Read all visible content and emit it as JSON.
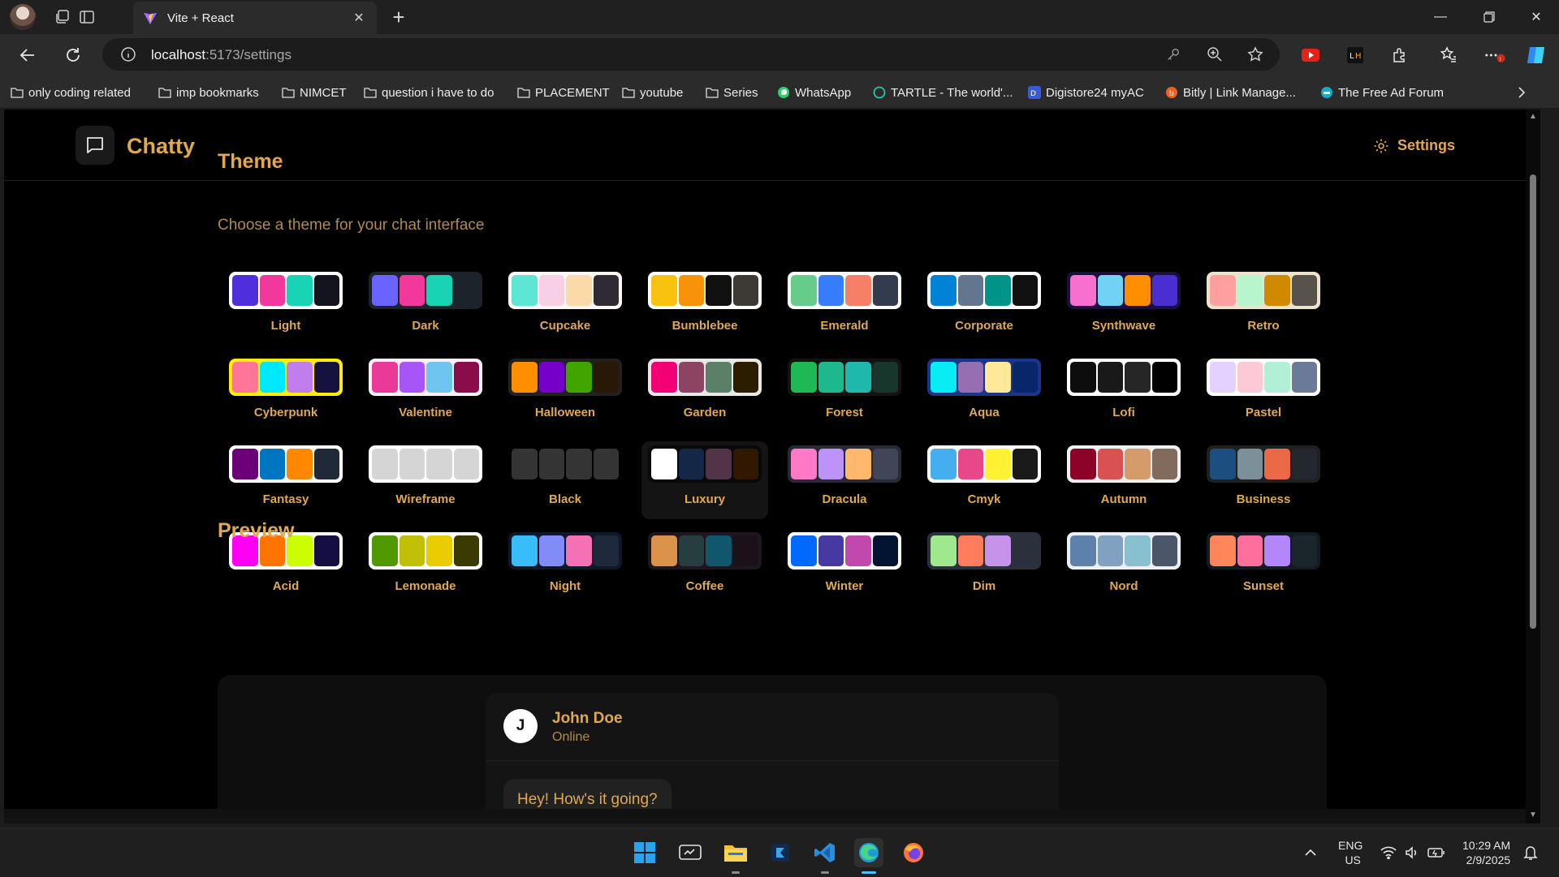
{
  "browser": {
    "tab_title": "Vite + React",
    "url_host": "localhost",
    "url_path": ":5173/settings",
    "bookmarks": [
      "only coding  related",
      "imp bookmarks",
      "NIMCET",
      "question i have to do",
      "PLACEMENT",
      "youtube",
      "Series",
      "WhatsApp",
      "TARTLE - The world'...",
      "Digistore24 myAC",
      "Bitly | Link Manage...",
      "The Free Ad Forum"
    ]
  },
  "app": {
    "name": "Chatty",
    "settings_label": "Settings",
    "theme_title": "Theme",
    "theme_subtitle": "Choose a theme for your chat interface",
    "preview_title": "Preview",
    "selected_theme": "Luxury",
    "themes": [
      {
        "name": "Light",
        "bg": "#ffffff",
        "colors": [
          "#4f2fdc",
          "#f2389c",
          "#19d3b5",
          "#14141f"
        ]
      },
      {
        "name": "Dark",
        "bg": "#1d232a",
        "colors": [
          "#6b63ff",
          "#f2389c",
          "#19d3b5",
          "#1d232a"
        ]
      },
      {
        "name": "Cupcake",
        "bg": "#faf7f5",
        "colors": [
          "#5ce6d3",
          "#f7d0e6",
          "#fcd9a8",
          "#2f2a33"
        ]
      },
      {
        "name": "Bumblebee",
        "bg": "#ffffff",
        "colors": [
          "#f9c20f",
          "#f79209",
          "#111111",
          "#3d3935"
        ]
      },
      {
        "name": "Emerald",
        "bg": "#ffffff",
        "colors": [
          "#66cc8a",
          "#377cfb",
          "#f68067",
          "#333c4d"
        ]
      },
      {
        "name": "Corporate",
        "bg": "#ffffff",
        "colors": [
          "#0083d6",
          "#637690",
          "#009488",
          "#111111"
        ]
      },
      {
        "name": "Synthwave",
        "bg": "#1a103d",
        "colors": [
          "#f770cf",
          "#72d2f5",
          "#ff8e00",
          "#4b2ed2"
        ]
      },
      {
        "name": "Retro",
        "bg": "#ece3ca",
        "colors": [
          "#ff9fa0",
          "#b7f6cd",
          "#d18a00",
          "#57524c"
        ]
      },
      {
        "name": "Cyberpunk",
        "bg": "#ffee00",
        "colors": [
          "#ff7598",
          "#00e8ff",
          "#c07eec",
          "#16123f"
        ]
      },
      {
        "name": "Valentine",
        "bg": "#fcf0f7",
        "colors": [
          "#e83a96",
          "#a855f7",
          "#6ec5ef",
          "#8a0c4b"
        ]
      },
      {
        "name": "Halloween",
        "bg": "#212121",
        "colors": [
          "#ff8f00",
          "#7600c9",
          "#42a400",
          "#2a1807"
        ]
      },
      {
        "name": "Garden",
        "bg": "#e9e7e7",
        "colors": [
          "#f40076",
          "#8d4462",
          "#5c7f67",
          "#2a1d00"
        ]
      },
      {
        "name": "Forest",
        "bg": "#171212",
        "colors": [
          "#1eb854",
          "#1eb88e",
          "#1eb8ad",
          "#19362d"
        ]
      },
      {
        "name": "Aqua",
        "bg": "#1a368b",
        "colors": [
          "#09ecf3",
          "#966fb3",
          "#ffe999",
          "#0a266b"
        ]
      },
      {
        "name": "Lofi",
        "bg": "#ffffff",
        "colors": [
          "#0d0d0d",
          "#1a1919",
          "#262626",
          "#000000"
        ]
      },
      {
        "name": "Pastel",
        "bg": "#ffffff",
        "colors": [
          "#e4d1ff",
          "#fdc9d6",
          "#b1f0d6",
          "#6b7a98"
        ]
      },
      {
        "name": "Fantasy",
        "bg": "#ffffff",
        "colors": [
          "#6c0079",
          "#0075c2",
          "#ff8800",
          "#1f2937"
        ]
      },
      {
        "name": "Wireframe",
        "bg": "#ffffff",
        "colors": [
          "#d5d5d5",
          "#d5d5d5",
          "#d5d5d5",
          "#d5d5d5"
        ]
      },
      {
        "name": "Black",
        "bg": "#000000",
        "colors": [
          "#343434",
          "#343434",
          "#343434",
          "#343434"
        ]
      },
      {
        "name": "Luxury",
        "bg": "#09090b",
        "colors": [
          "#ffffff",
          "#152747",
          "#513448",
          "#331800"
        ]
      },
      {
        "name": "Dracula",
        "bg": "#282a36",
        "colors": [
          "#ff79c6",
          "#bd93f9",
          "#ffb86c",
          "#414558"
        ]
      },
      {
        "name": "Cmyk",
        "bg": "#ffffff",
        "colors": [
          "#45aeee",
          "#e8488a",
          "#fff232",
          "#1a1a1a"
        ]
      },
      {
        "name": "Autumn",
        "bg": "#f1f1f1",
        "colors": [
          "#8c0327",
          "#d85251",
          "#d59b6a",
          "#826a5c"
        ]
      },
      {
        "name": "Business",
        "bg": "#202020",
        "colors": [
          "#1c4e80",
          "#7c909a",
          "#ea6947",
          "#23282e"
        ]
      },
      {
        "name": "Acid",
        "bg": "#fafafa",
        "colors": [
          "#ff00f4",
          "#ff7400",
          "#cbfd03",
          "#140f40"
        ]
      },
      {
        "name": "Lemonade",
        "bg": "#ffffff",
        "colors": [
          "#519903",
          "#c2bf07",
          "#eacd00",
          "#3b3b00"
        ]
      },
      {
        "name": "Night",
        "bg": "#0f172a",
        "colors": [
          "#38bdf8",
          "#818cf8",
          "#f471b5",
          "#1e293b"
        ]
      },
      {
        "name": "Coffee",
        "bg": "#20161f",
        "colors": [
          "#db924b",
          "#263e3f",
          "#10576d",
          "#1a1218"
        ]
      },
      {
        "name": "Winter",
        "bg": "#ffffff",
        "colors": [
          "#0069ff",
          "#463aa2",
          "#c148ac",
          "#021431"
        ]
      },
      {
        "name": "Dim",
        "bg": "#2a303c",
        "colors": [
          "#9fe88d",
          "#ff7d5c",
          "#c792e9",
          "#2a303c"
        ]
      },
      {
        "name": "Nord",
        "bg": "#eceff4",
        "colors": [
          "#5e81ac",
          "#81a1c1",
          "#88c0d0",
          "#4c566a"
        ]
      },
      {
        "name": "Sunset",
        "bg": "#121c22",
        "colors": [
          "#ff865b",
          "#fd6f9c",
          "#b387fa",
          "#1b262c"
        ]
      }
    ],
    "preview": {
      "avatar_initial": "J",
      "contact_name": "John Doe",
      "contact_status": "Online",
      "message": "Hey! How's it going?"
    }
  },
  "taskbar": {
    "language": "ENG",
    "region": "US",
    "time": "10:29 AM",
    "date": "2/9/2025"
  },
  "colors": {
    "accent": "#e0a94f",
    "page_bg": "#000000"
  }
}
